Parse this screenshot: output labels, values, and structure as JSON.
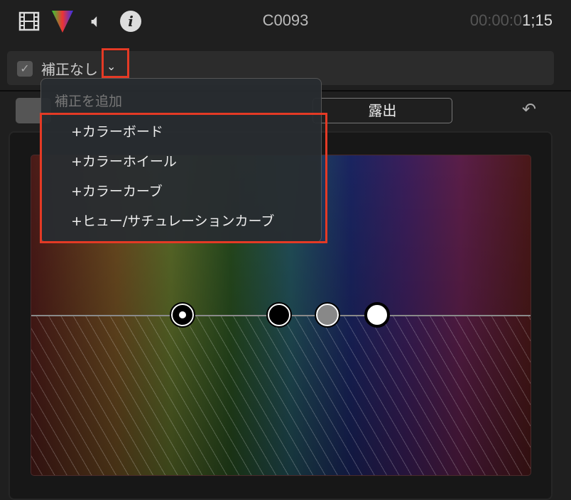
{
  "header": {
    "icons": [
      "film-icon",
      "color-icon",
      "audio-icon",
      "info-icon"
    ],
    "title": "C0093",
    "timecode_dim": "00:00:0",
    "timecode_hi": "1;15"
  },
  "correction": {
    "enabled": true,
    "label": "補正なし"
  },
  "tabs": {
    "exposure": "露出"
  },
  "menu": {
    "header": "補正を追加",
    "items": [
      "+カラーボード",
      "+カラーホイール",
      "+カラーカーブ",
      "+ヒュー/サチュレーションカーブ"
    ]
  },
  "colors": {
    "highlight": "#e43a25"
  },
  "pucks": [
    "global",
    "shadows",
    "midtones",
    "highlights"
  ]
}
